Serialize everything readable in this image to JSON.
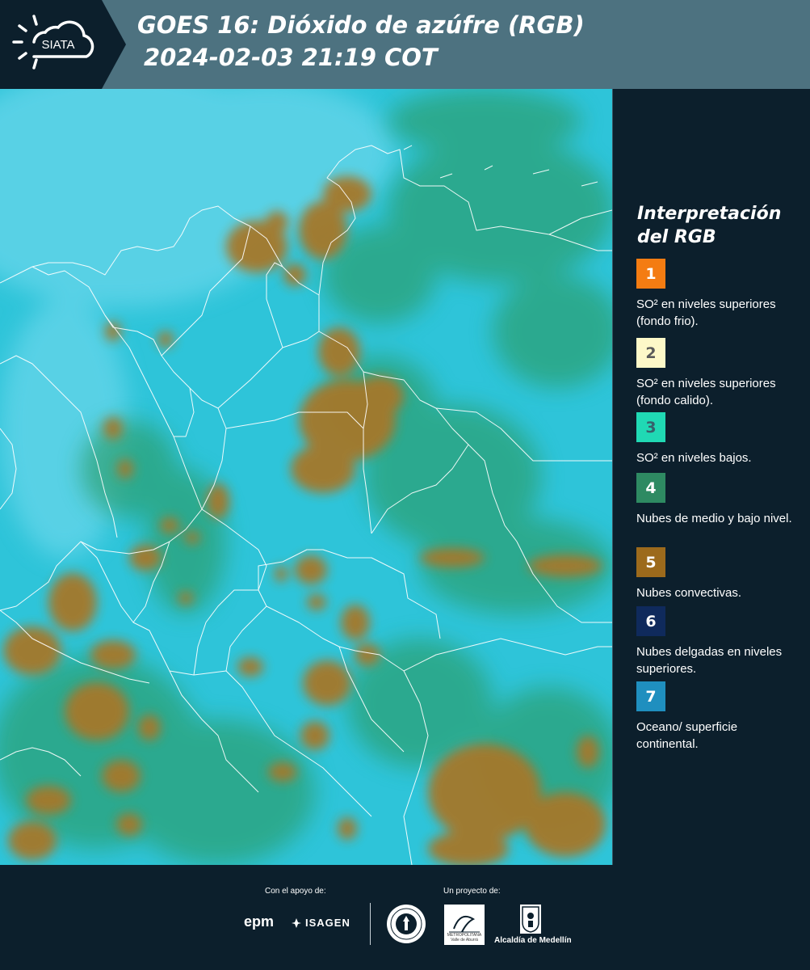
{
  "header": {
    "logo_text": "SIATA",
    "title_line1": "GOES 16: Dióxido de azúfre (RGB)",
    "title_line2": "2024-02-03 21:19 COT"
  },
  "map": {
    "colors": {
      "background": "#2ec4d9",
      "ocean_pale": "#66d6ea",
      "low_clouds": "#2a9c68",
      "convective": "#a5782c",
      "borders": "#ffffff"
    }
  },
  "legend": {
    "title": "Interpretación del RGB",
    "items": [
      {
        "number": "1",
        "color": "#f47c12",
        "num_color": "#ffffff",
        "text": "SO² en niveles superiores (fondo frio)."
      },
      {
        "number": "2",
        "color": "#fdf8c8",
        "num_color": "#5a5a5a",
        "text": "SO² en niveles superiores (fondo calido)."
      },
      {
        "number": "3",
        "color": "#20d9b4",
        "num_color": "#37606b",
        "text": "SO² en niveles bajos."
      },
      {
        "number": "4",
        "color": "#2e8a62",
        "num_color": "#ffffff",
        "text": "Nubes de medio y bajo nivel."
      },
      {
        "number": "5",
        "color": "#9c6a1c",
        "num_color": "#ffffff",
        "text": "Nubes convectivas."
      },
      {
        "number": "6",
        "color": "#0f2a5c",
        "num_color": "#ffffff",
        "text": "Nubes delgadas en niveles superiores."
      },
      {
        "number": "7",
        "color": "#1f8fbf",
        "num_color": "#ffffff",
        "text": "Oceano/ superficie continental."
      }
    ]
  },
  "footer": {
    "support_label": "Con el apoyo de:",
    "project_label": "Un proyecto de:",
    "epm_logo": "epm",
    "isagen_logo": "ISAGEN",
    "area_logo_label": "METROPOLITANA Valle de Aburrá",
    "alcaldia_label": "Alcaldía de Medellín"
  }
}
